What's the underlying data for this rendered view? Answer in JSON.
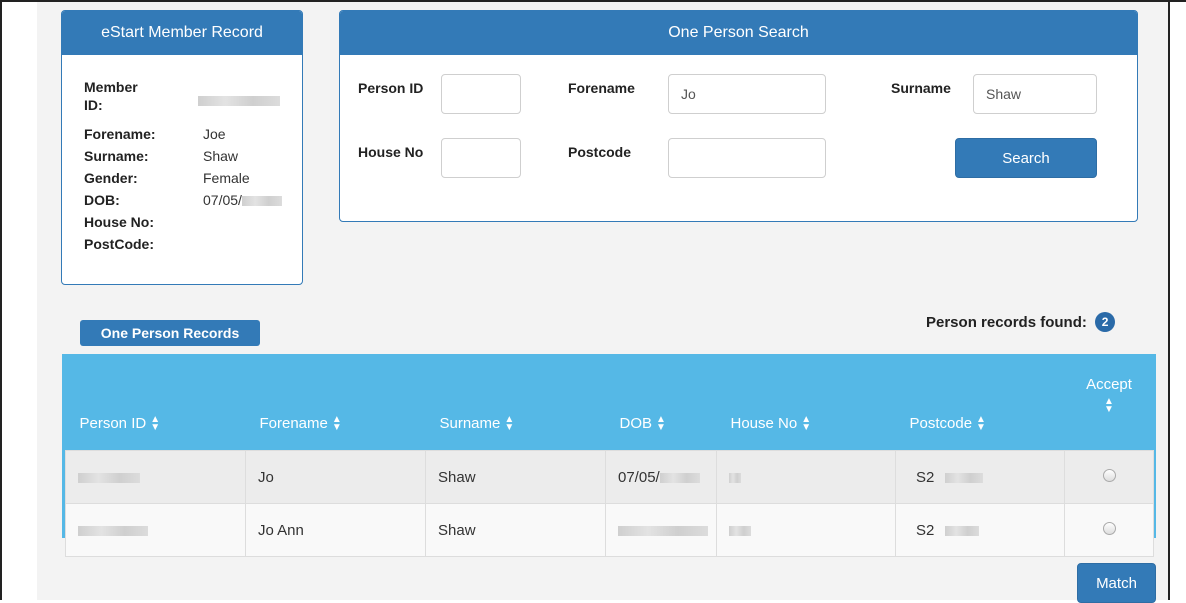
{
  "member_record": {
    "title": "eStart Member Record",
    "member_id_label_1": "Member",
    "member_id_label_2": "ID:",
    "forename_label": "Forename:",
    "forename": "Joe",
    "surname_label": "Surname:",
    "surname": "Shaw",
    "gender_label": "Gender:",
    "gender": "Female",
    "dob_label": "DOB:",
    "dob": "07/05/",
    "house_no_label": "House No:",
    "postcode_label": "PostCode:"
  },
  "search": {
    "title": "One Person Search",
    "person_id_label": "Person ID",
    "person_id_value": "",
    "forename_label": "Forename",
    "forename_value": "Jo",
    "surname_label": "Surname",
    "surname_value": "Shaw",
    "house_no_label": "House No",
    "house_no_value": "",
    "postcode_label": "Postcode",
    "postcode_value": "",
    "search_button": "Search"
  },
  "records": {
    "title": "One Person Records",
    "found_label": "Person records found:",
    "found_count": "2",
    "columns": [
      "Person ID",
      "Forename",
      "Surname",
      "DOB",
      "House No",
      "Postcode",
      "Accept"
    ],
    "rows": [
      {
        "forename": "Jo",
        "surname": "Shaw",
        "dob": "07/05/",
        "postcode": "S2"
      },
      {
        "forename": "Jo Ann",
        "surname": "Shaw",
        "postcode": "S2"
      }
    ]
  },
  "match_button": "Match",
  "colors": {
    "primary": "#337ab7",
    "table_header": "#55b8e6"
  },
  "icons": [
    "sort-icon",
    "radio-icon"
  ]
}
